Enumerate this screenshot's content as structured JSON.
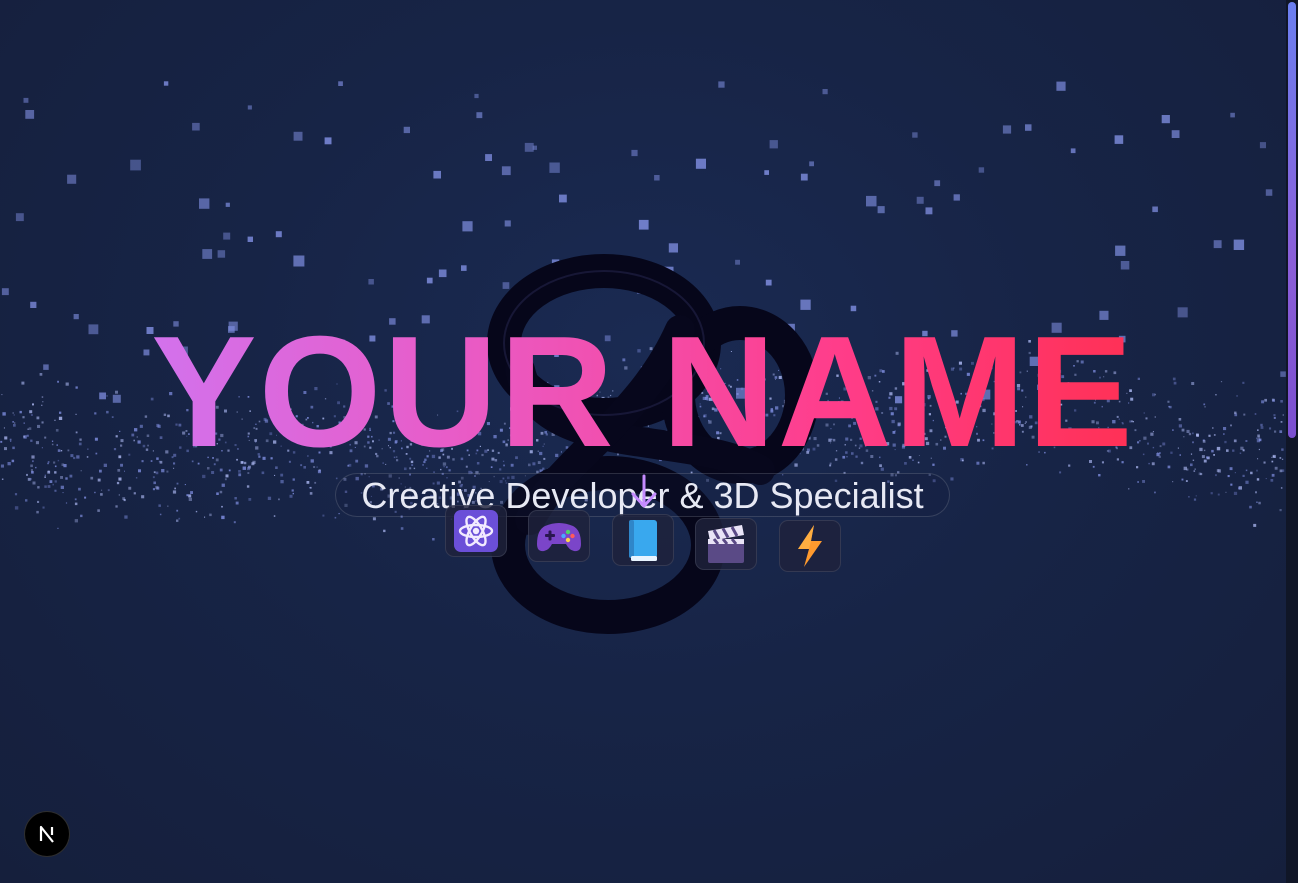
{
  "hero": {
    "title": "YOUR NAME",
    "subtitle": "Creative Developer & 3D Specialist"
  },
  "skills": [
    {
      "name": "react",
      "icon": "atom-icon"
    },
    {
      "name": "game-dev",
      "icon": "gamepad-icon"
    },
    {
      "name": "docs",
      "icon": "book-icon"
    },
    {
      "name": "video",
      "icon": "clapperboard-icon"
    },
    {
      "name": "performance",
      "icon": "lightning-icon"
    }
  ],
  "scroll_indicator": {
    "icon": "arrow-down-icon"
  },
  "dev_badge": {
    "icon": "nextjs-logo-icon"
  },
  "colors": {
    "background": "#172444",
    "title_gradient": [
      "#c77dff",
      "#ff2a3a"
    ],
    "particle": "#7f8ee0",
    "scrollbar_thumb": "#6b7ff0"
  }
}
